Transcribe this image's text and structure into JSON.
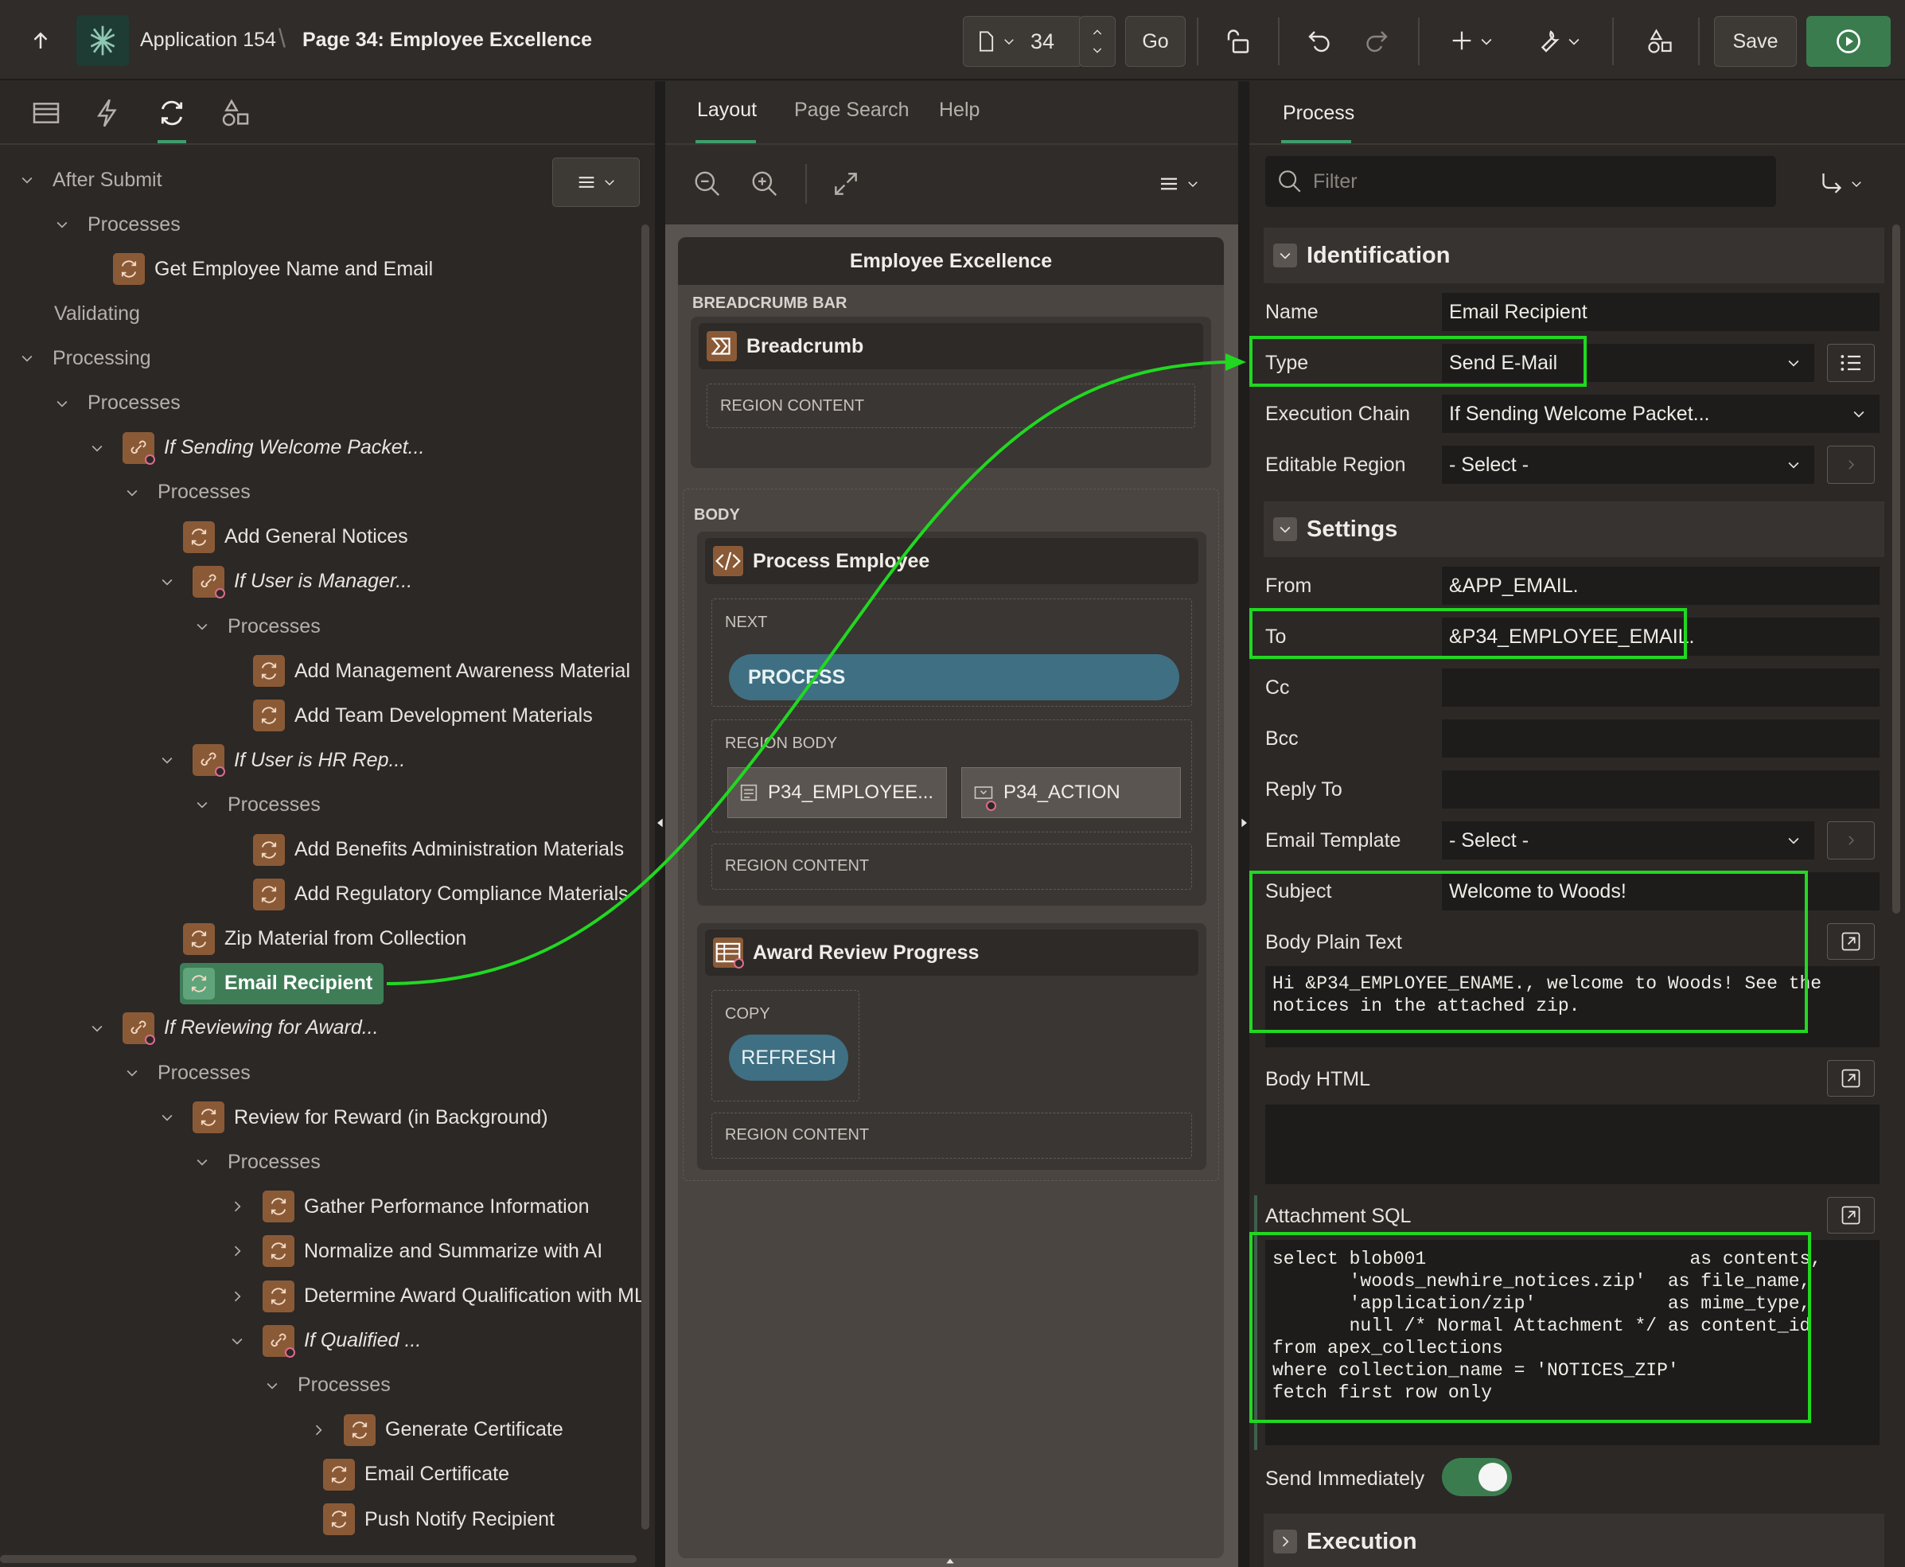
{
  "header": {
    "app_label": "Application 154",
    "page_label": "Page 34: Employee Excellence",
    "page_number": "34",
    "go_label": "Go",
    "save_label": "Save"
  },
  "left_panel": {
    "tree": [
      {
        "label": "After Submit",
        "kind": "group"
      },
      {
        "label": "Processes",
        "kind": "folder"
      },
      {
        "label": "Get Employee Name and Email",
        "kind": "process"
      },
      {
        "label": "Validating",
        "kind": "group"
      },
      {
        "label": "Processing",
        "kind": "group"
      },
      {
        "label": "Processes",
        "kind": "folder"
      },
      {
        "label": "If Sending Welcome Packet...",
        "kind": "chain"
      },
      {
        "label": "Processes",
        "kind": "folder"
      },
      {
        "label": "Add General Notices",
        "kind": "process"
      },
      {
        "label": "If User is Manager...",
        "kind": "chain"
      },
      {
        "label": "Processes",
        "kind": "folder"
      },
      {
        "label": "Add Management Awareness Material",
        "kind": "process"
      },
      {
        "label": "Add Team Development Materials",
        "kind": "process"
      },
      {
        "label": "If User is HR Rep...",
        "kind": "chain"
      },
      {
        "label": "Processes",
        "kind": "folder"
      },
      {
        "label": "Add Benefits Administration Materials",
        "kind": "process"
      },
      {
        "label": "Add Regulatory Compliance Materials",
        "kind": "process"
      },
      {
        "label": "Zip Material from Collection",
        "kind": "process"
      },
      {
        "label": "Email Recipient",
        "kind": "process-selected"
      },
      {
        "label": "If Reviewing for Award...",
        "kind": "chain"
      },
      {
        "label": "Processes",
        "kind": "folder"
      },
      {
        "label": "Review for Reward (in Background)",
        "kind": "chain-plain"
      },
      {
        "label": "Processes",
        "kind": "folder"
      },
      {
        "label": "Gather Performance Information",
        "kind": "process"
      },
      {
        "label": "Normalize and Summarize with AI",
        "kind": "process"
      },
      {
        "label": "Determine Award Qualification with ML",
        "kind": "process"
      },
      {
        "label": "If Qualified ...",
        "kind": "chain"
      },
      {
        "label": "Processes",
        "kind": "folder"
      },
      {
        "label": "Generate Certificate",
        "kind": "process"
      },
      {
        "label": "Email Certificate",
        "kind": "process"
      },
      {
        "label": "Push Notify Recipient",
        "kind": "process"
      }
    ]
  },
  "middle_panel": {
    "tabs": [
      "Layout",
      "Page Search",
      "Help"
    ],
    "page_title": "Employee Excellence",
    "breadcrumb_bar_label": "BREADCRUMB BAR",
    "breadcrumb_region": "Breadcrumb",
    "region_content_label": "REGION CONTENT",
    "body_label": "BODY",
    "process_region": "Process Employee",
    "next_label": "NEXT",
    "process_button": "PROCESS",
    "region_body_label": "REGION BODY",
    "item1": "P34_EMPLOYEE...",
    "item2": "P34_ACTION",
    "award_region": "Award Review Progress",
    "copy_label": "COPY",
    "refresh_button": "REFRESH"
  },
  "right_panel": {
    "tab": "Process",
    "filter_placeholder": "Filter",
    "identification": {
      "title": "Identification",
      "name_label": "Name",
      "name_value": "Email Recipient",
      "type_label": "Type",
      "type_value": "Send E-Mail",
      "chain_label": "Execution Chain",
      "chain_value": "If Sending Welcome Packet...",
      "region_label": "Editable Region",
      "region_value": "- Select -"
    },
    "settings": {
      "title": "Settings",
      "from_label": "From",
      "from_value": "&APP_EMAIL.",
      "to_label": "To",
      "to_value": "&P34_EMPLOYEE_EMAIL.",
      "cc_label": "Cc",
      "bcc_label": "Bcc",
      "reply_label": "Reply To",
      "template_label": "Email Template",
      "template_value": "- Select -",
      "subject_label": "Subject",
      "subject_value": "Welcome to Woods!",
      "body_plain_label": "Body Plain Text",
      "body_plain_value": "Hi &P34_EMPLOYEE_ENAME., welcome to Woods! See the\nnotices in the attached zip.",
      "body_html_label": "Body HTML",
      "attachment_label": "Attachment SQL",
      "attachment_value": "select blob001                        as contents,\n       'woods_newhire_notices.zip'  as file_name,\n       'application/zip'            as mime_type,\n       null /* Normal Attachment */ as content_id\nfrom apex_collections\nwhere collection_name = 'NOTICES_ZIP'\nfetch first row only",
      "send_label": "Send Immediately",
      "send_on": true
    },
    "execution_title": "Execution"
  },
  "colors": {
    "highlight": "#21d821",
    "selected_tree_item": "#3f7d57",
    "run_button": "#3b7c4f",
    "button_pill": "#3f6f82",
    "process_icon": "#8a5a37"
  }
}
